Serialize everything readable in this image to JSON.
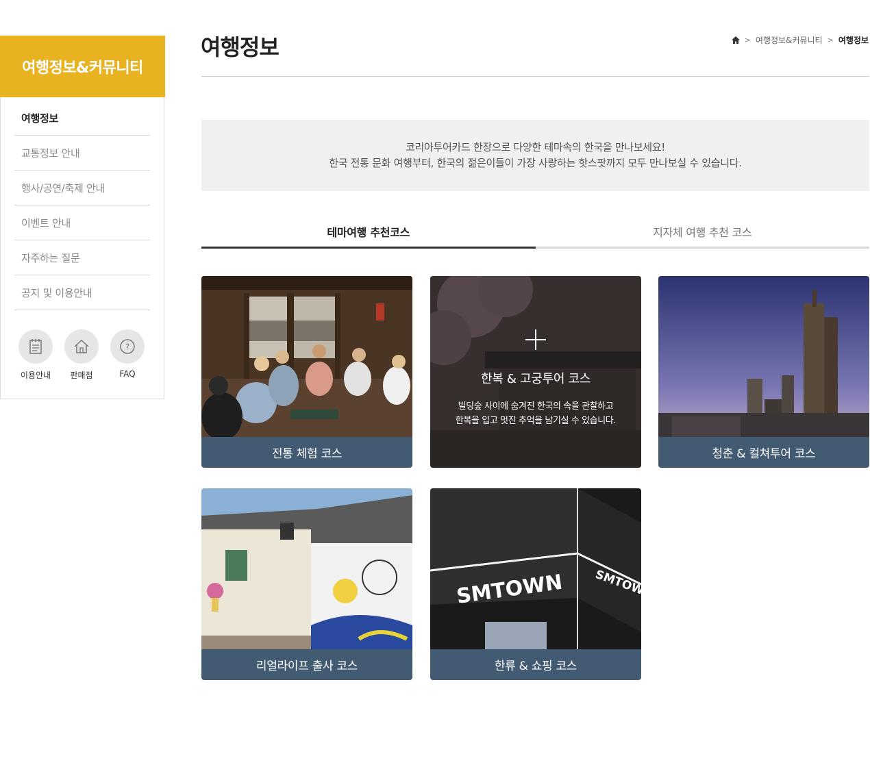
{
  "sidebar": {
    "title": "여행정보&커뮤니티",
    "items": [
      {
        "label": "여행정보"
      },
      {
        "label": "교통정보 안내"
      },
      {
        "label": "행사/공연/축제 안내"
      },
      {
        "label": "이벤트 안내"
      },
      {
        "label": "자주하는 질문"
      },
      {
        "label": "공지 및 이용안내"
      }
    ],
    "quick_links": [
      {
        "label": "이용안내",
        "icon": "notepad-icon"
      },
      {
        "label": "판매점",
        "icon": "home-icon"
      },
      {
        "label": "FAQ",
        "icon": "question-icon"
      }
    ]
  },
  "header": {
    "title": "여행정보",
    "breadcrumb": [
      "여행정보&커뮤니티",
      "여행정보"
    ]
  },
  "intro": {
    "line1": "코리아투어카드 한장으로 다양한 테마속의 한국을 만나보세요!",
    "line2": "한국 전통 문화 여행부터, 한국의 젊은이들이 가장 사랑하는 핫스팟까지 모두 만나보실 수 있습니다."
  },
  "tabs": [
    {
      "label": "테마여행 추천코스"
    },
    {
      "label": "지자체 여행 추천 코스"
    }
  ],
  "courses": [
    {
      "label": "전통 체험 코스"
    },
    {
      "label": "한복 & 고궁투어 코스",
      "desc1": "빌딩숲 사이에 숨겨진 한국의 속을 관찰하고",
      "desc2": "한복을 입고 멋진 추억을 남기실 수 있습니다."
    },
    {
      "label": "청춘 & 컬쳐투어 코스"
    },
    {
      "label": "리얼라이프 출사 코스"
    },
    {
      "label": "한류 & 쇼핑 코스",
      "sign": "SMTOWN"
    }
  ],
  "colors": {
    "accent": "#e8b221",
    "card_bar": "#435b72",
    "intro_bg": "#f0f0f1"
  }
}
